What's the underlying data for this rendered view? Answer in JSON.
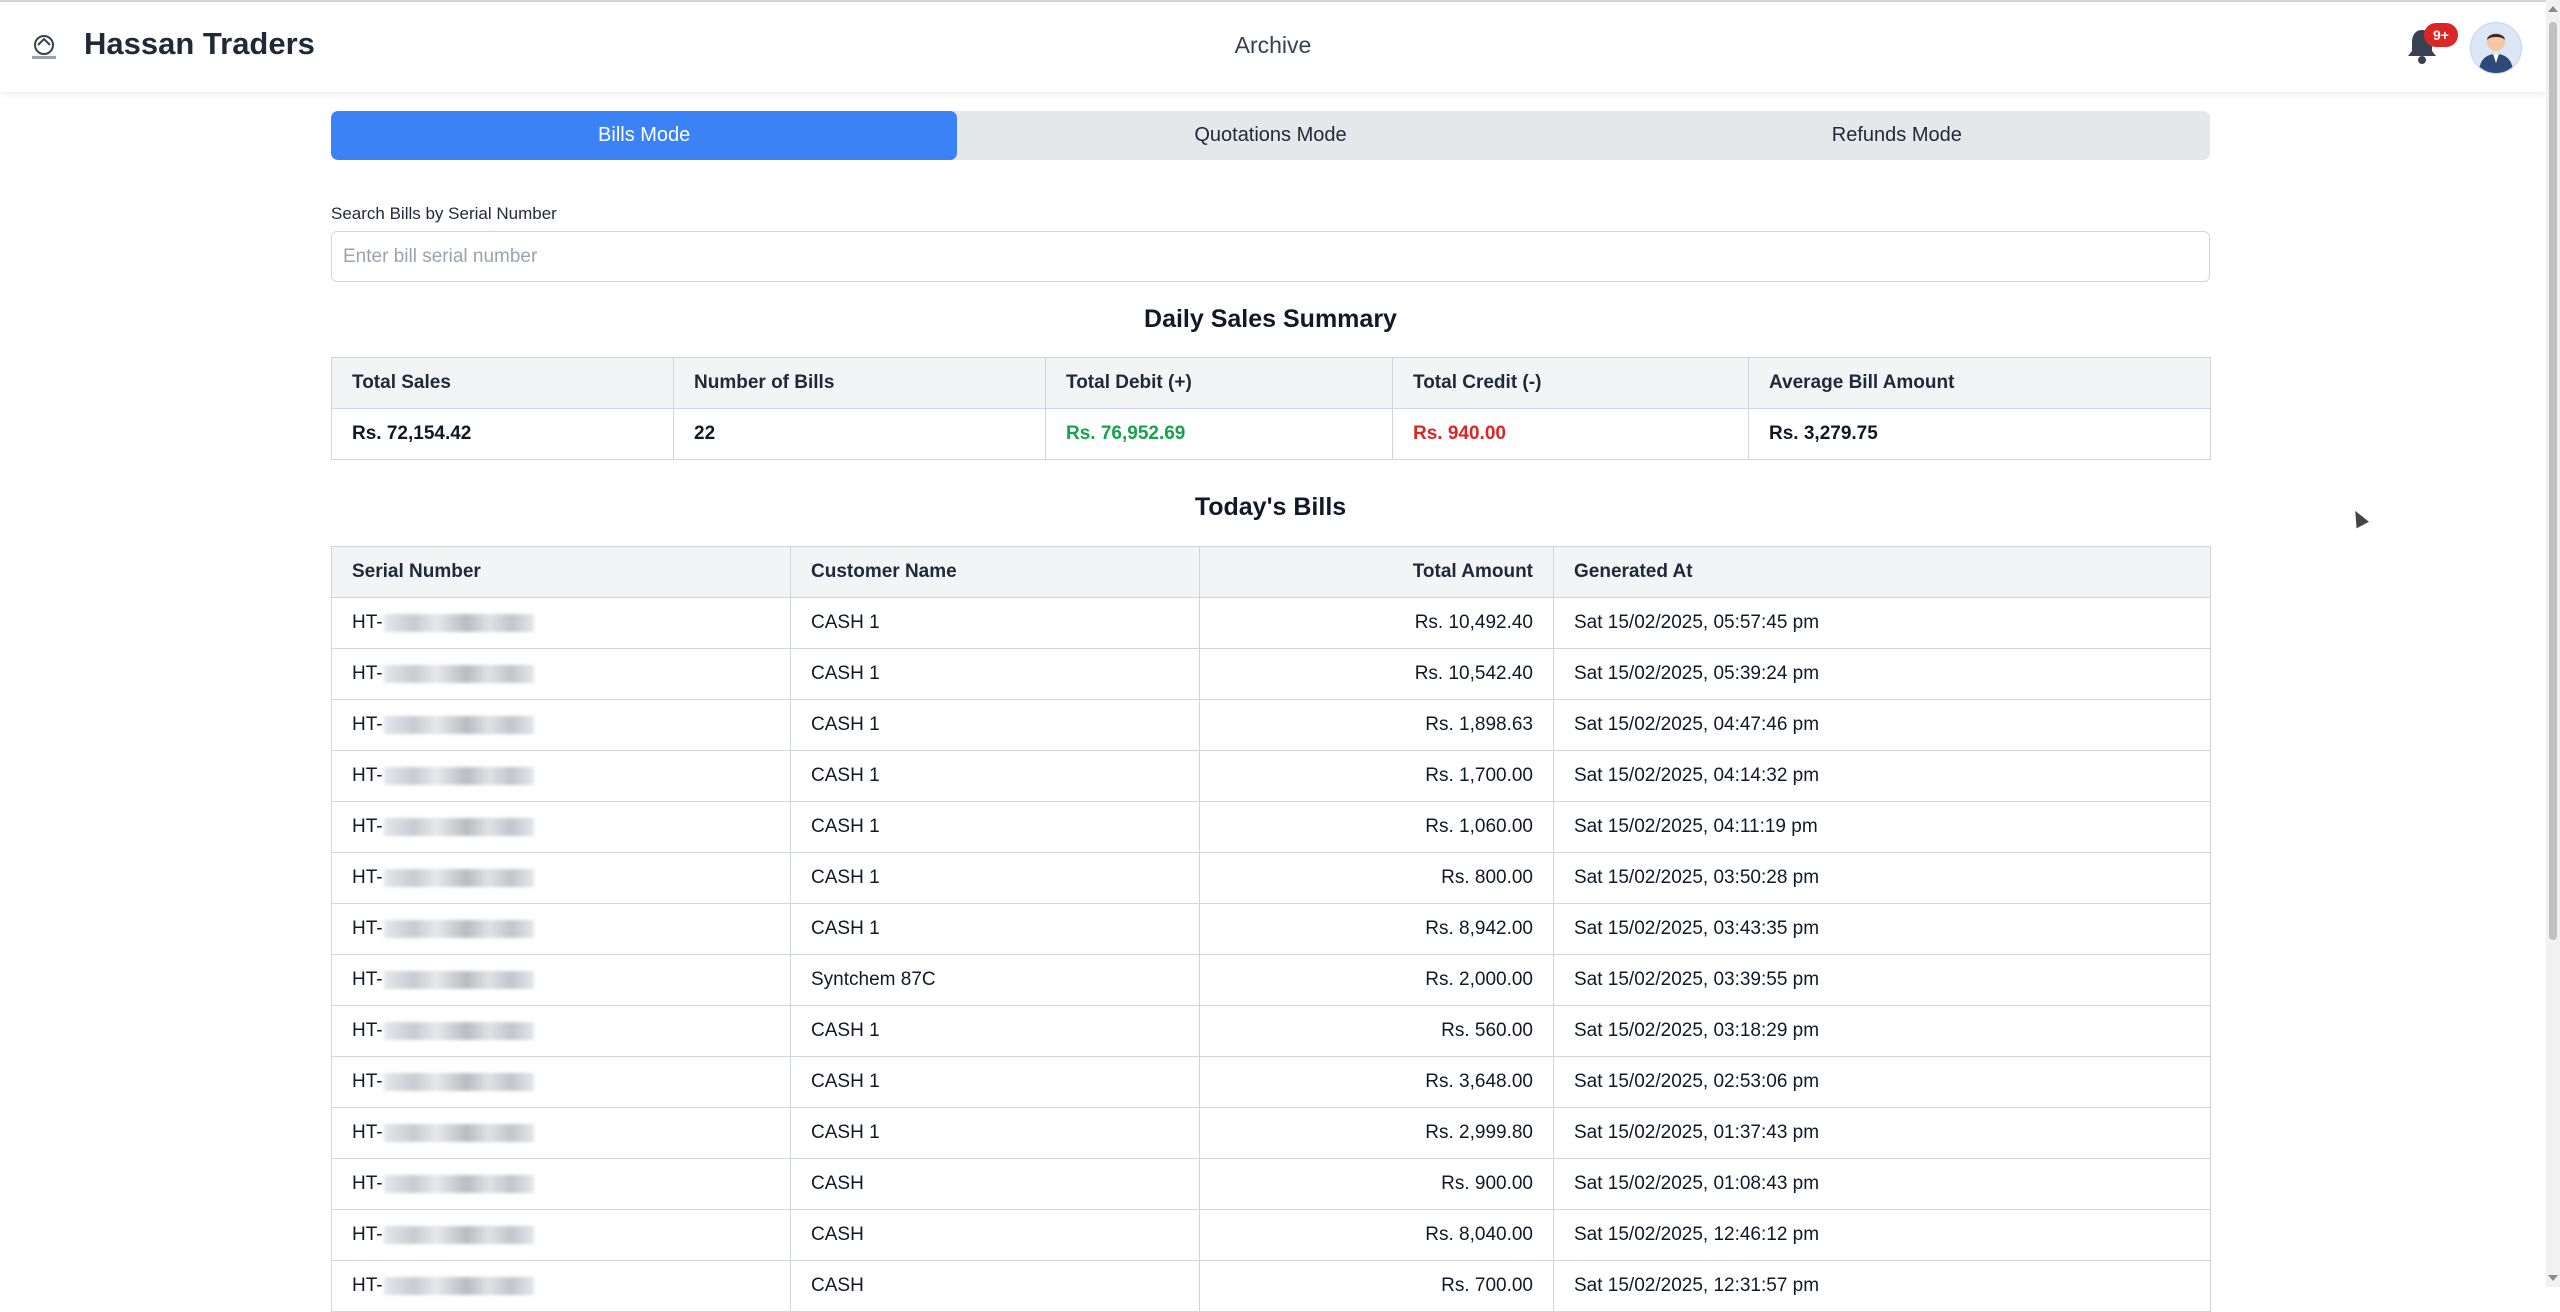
{
  "header": {
    "brand": "Hassan Traders",
    "page_title": "Archive",
    "notification_badge": "9+"
  },
  "tabs": [
    {
      "label": "Bills Mode",
      "active": true
    },
    {
      "label": "Quotations Mode",
      "active": false
    },
    {
      "label": "Refunds Mode",
      "active": false
    }
  ],
  "search": {
    "label": "Search Bills by Serial Number",
    "placeholder": "Enter bill serial number",
    "value": ""
  },
  "summary": {
    "title": "Daily Sales Summary",
    "headers": [
      "Total Sales",
      "Number of Bills",
      "Total Debit (+)",
      "Total Credit (-)",
      "Average Bill Amount"
    ],
    "values": [
      "Rs. 72,154.42",
      "22",
      "Rs. 76,952.69",
      "Rs. 940.00",
      "Rs. 3,279.75"
    ],
    "colors": {
      "debit": "#16a34a",
      "credit": "#dc2626"
    }
  },
  "bills": {
    "title": "Today's Bills",
    "headers": [
      "Serial Number",
      "Customer Name",
      "Total Amount",
      "Generated At"
    ],
    "serial_prefix": "HT-",
    "rows": [
      {
        "customer": "CASH 1",
        "amount": "Rs. 10,492.40",
        "generated": "Sat 15/02/2025, 05:57:45 pm"
      },
      {
        "customer": "CASH 1",
        "amount": "Rs. 10,542.40",
        "generated": "Sat 15/02/2025, 05:39:24 pm"
      },
      {
        "customer": "CASH 1",
        "amount": "Rs. 1,898.63",
        "generated": "Sat 15/02/2025, 04:47:46 pm"
      },
      {
        "customer": "CASH 1",
        "amount": "Rs. 1,700.00",
        "generated": "Sat 15/02/2025, 04:14:32 pm"
      },
      {
        "customer": "CASH 1",
        "amount": "Rs. 1,060.00",
        "generated": "Sat 15/02/2025, 04:11:19 pm"
      },
      {
        "customer": "CASH 1",
        "amount": "Rs. 800.00",
        "generated": "Sat 15/02/2025, 03:50:28 pm"
      },
      {
        "customer": "CASH 1",
        "amount": "Rs. 8,942.00",
        "generated": "Sat 15/02/2025, 03:43:35 pm"
      },
      {
        "customer": "Syntchem 87C",
        "amount": "Rs. 2,000.00",
        "generated": "Sat 15/02/2025, 03:39:55 pm"
      },
      {
        "customer": "CASH 1",
        "amount": "Rs. 560.00",
        "generated": "Sat 15/02/2025, 03:18:29 pm"
      },
      {
        "customer": "CASH 1",
        "amount": "Rs. 3,648.00",
        "generated": "Sat 15/02/2025, 02:53:06 pm"
      },
      {
        "customer": "CASH 1",
        "amount": "Rs. 2,999.80",
        "generated": "Sat 15/02/2025, 01:37:43 pm"
      },
      {
        "customer": "CASH",
        "amount": "Rs. 900.00",
        "generated": "Sat 15/02/2025, 01:08:43 pm"
      },
      {
        "customer": "CASH",
        "amount": "Rs. 8,040.00",
        "generated": "Sat 15/02/2025, 12:46:12 pm"
      },
      {
        "customer": "CASH",
        "amount": "Rs. 700.00",
        "generated": "Sat 15/02/2025, 12:31:57 pm"
      }
    ]
  },
  "icons": [
    "logo-icon",
    "bell-icon",
    "avatar-icon"
  ]
}
